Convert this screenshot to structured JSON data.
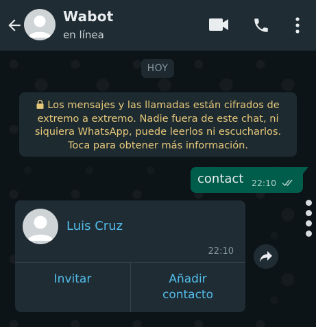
{
  "header": {
    "contact_name": "Wabot",
    "status": "en línea",
    "back_icon": "arrow-left-icon",
    "video_icon": "video-camera-icon",
    "call_icon": "phone-icon",
    "menu_icon": "more-vertical-icon"
  },
  "chat": {
    "date_label": "HOY",
    "encryption_notice": "Los mensajes y las llamadas están cifrados de extremo a extremo. Nadie fuera de este chat, ni siquiera WhatsApp, puede leerlos ni escucharlos. Toca para obtener más información.",
    "outgoing_message": {
      "text": "contact",
      "time": "22:10",
      "status": "read"
    },
    "contact_card": {
      "name": "Luis Cruz",
      "time": "22:10",
      "invite_label": "Invitar",
      "add_label": "Añadir contacto"
    }
  },
  "colors": {
    "header_bg": "#1f2c34",
    "chat_bg": "#0b141a",
    "outgoing_bubble": "#005c4b",
    "incoming_bubble": "#1f2c34",
    "link_blue": "#53bdeb",
    "notice_text": "#e8c97a"
  }
}
